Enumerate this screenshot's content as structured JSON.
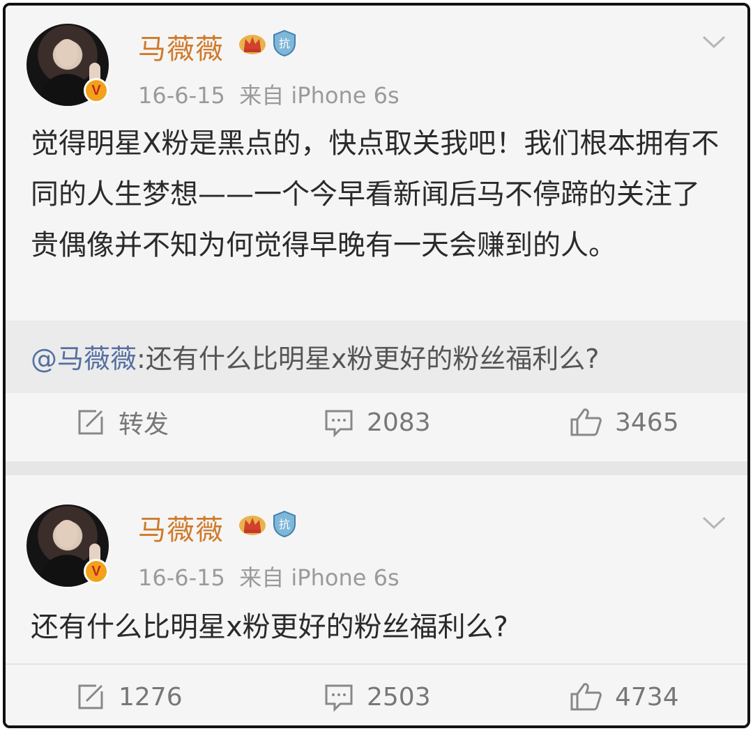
{
  "posts": [
    {
      "author": "马薇薇",
      "time": "16-6-15",
      "source": "来自 iPhone 6s",
      "text": "觉得明星X粉是黑点的，快点取关我吧！我们根本拥有不同的人生梦想——一个今早看新闻后马不停蹄的关注了贵偶像并不知为何觉得早晚有一天会赚到的人。",
      "quote": {
        "mention": "@马薇薇",
        "text": ":还有什么比明星x粉更好的粉丝福利么?"
      },
      "actions": {
        "repost": "转发",
        "comments": "2083",
        "likes": "3465"
      }
    },
    {
      "author": "马薇薇",
      "time": "16-6-15",
      "source": "来自 iPhone 6s",
      "text": "还有什么比明星x粉更好的粉丝福利么?",
      "actions": {
        "repost": "1276",
        "comments": "2503",
        "likes": "4734"
      }
    }
  ],
  "icons": {
    "crown": "crown-icon",
    "shield": "shield-badge-icon",
    "verified": "verified-v-icon",
    "repost": "repost-icon",
    "comment": "comment-icon",
    "like": "like-icon",
    "menu": "chevron-down-icon"
  },
  "colors": {
    "name": "#d07a2a",
    "meta": "#9a9a9a",
    "mention": "#5570a0",
    "badge": "#f2a21a"
  }
}
